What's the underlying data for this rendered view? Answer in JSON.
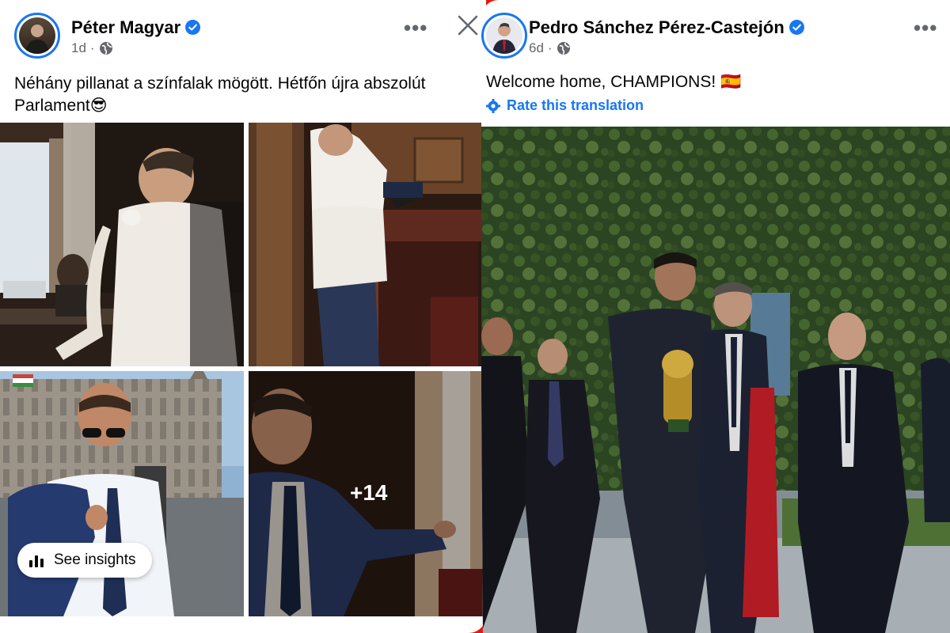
{
  "left_post": {
    "author": "Péter Magyar",
    "time": "1d",
    "more_label": "•••",
    "text_line1": "Néhány pillanat a színfalak mögött. Hétfőn újra abszolút",
    "text_line2": "Parlament😎",
    "more_photos": "+14",
    "insights_label": "See insights"
  },
  "right_post": {
    "author": "Pedro Sánchez Pérez-Castejón",
    "time": "6d",
    "more_label": "•••",
    "text": "Welcome home, CHAMPIONS! 🇪🇸",
    "translate_label": "Rate this translation"
  },
  "colors": {
    "accent": "#1877f2",
    "background_frame": "#e8160f",
    "text_primary": "#050505",
    "text_secondary": "#65676b"
  },
  "icons": [
    "verified-badge-icon",
    "globe-icon",
    "more-icon",
    "close-icon",
    "gear-icon",
    "bar-chart-icon"
  ]
}
